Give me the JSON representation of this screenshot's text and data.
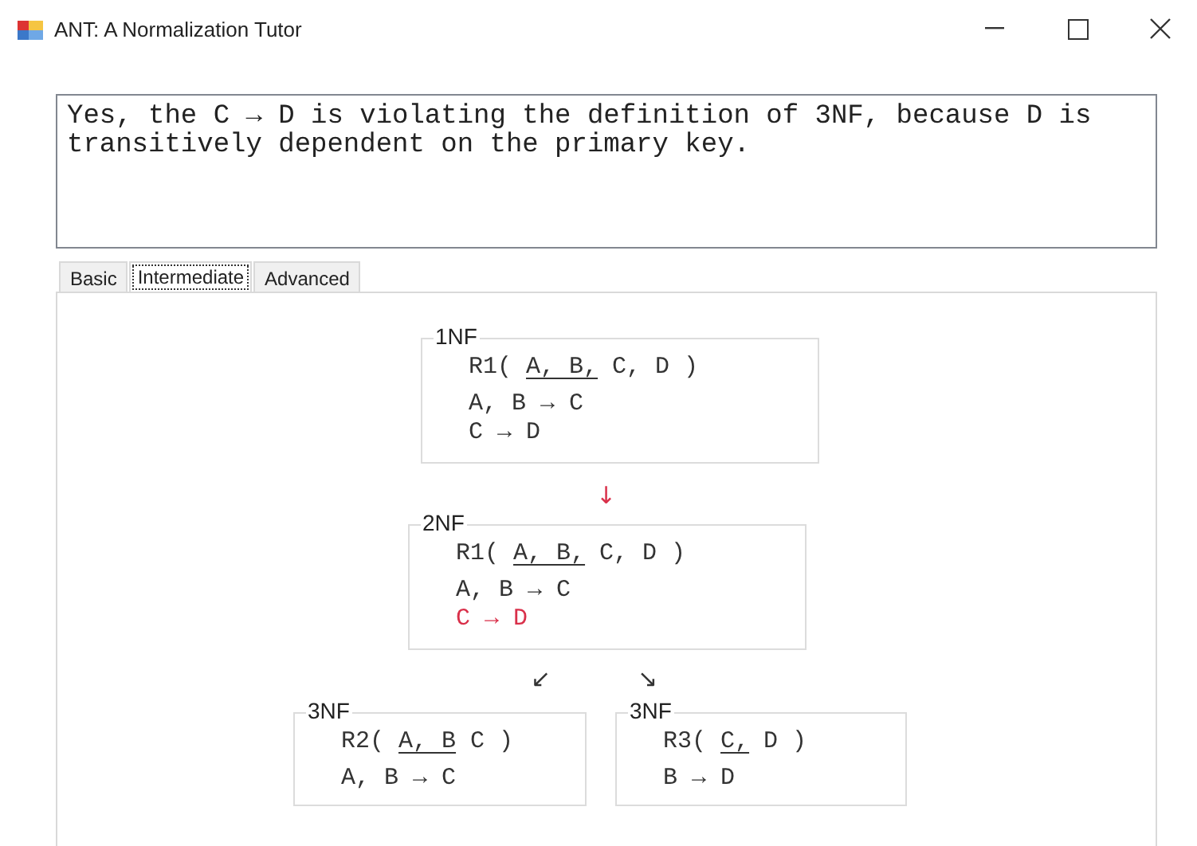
{
  "window": {
    "title": "ANT: A Normalization Tutor"
  },
  "feedback": {
    "value": "Yes, the C → D is violating the definition of 3NF, because D is transitively dependent on the primary key."
  },
  "tabs": [
    {
      "label": "Basic",
      "selected": false
    },
    {
      "label": "Intermediate",
      "selected": true
    },
    {
      "label": "Advanced",
      "selected": false
    }
  ],
  "diagram": {
    "boxes": [
      {
        "label": "1NF",
        "relation": {
          "name": "R1(",
          "key": "A, B,",
          "rest": "C, D )"
        },
        "dependencies": [
          {
            "text": "A, B → C",
            "highlighted": false
          },
          {
            "text": "C → D",
            "highlighted": false
          }
        ]
      },
      {
        "label": "2NF",
        "relation": {
          "name": "R1(",
          "key": "A, B,",
          "rest": "C, D )"
        },
        "dependencies": [
          {
            "text": "A, B → C",
            "highlighted": false
          },
          {
            "text": "C → D",
            "highlighted": true
          }
        ]
      },
      {
        "label": "3NF",
        "relation": {
          "name": "R2(",
          "key": "A, B",
          "rest": "C )"
        },
        "dependencies": [
          {
            "text": "A, B → C",
            "highlighted": false
          }
        ]
      },
      {
        "label": "3NF",
        "relation": {
          "name": "R3(",
          "key": "C,",
          "rest": "D )"
        },
        "dependencies": [
          {
            "text": "B → D",
            "highlighted": false
          }
        ]
      }
    ],
    "arrows": [
      {
        "text": "↓"
      },
      {
        "text": "↙"
      },
      {
        "text": "↘"
      }
    ]
  }
}
